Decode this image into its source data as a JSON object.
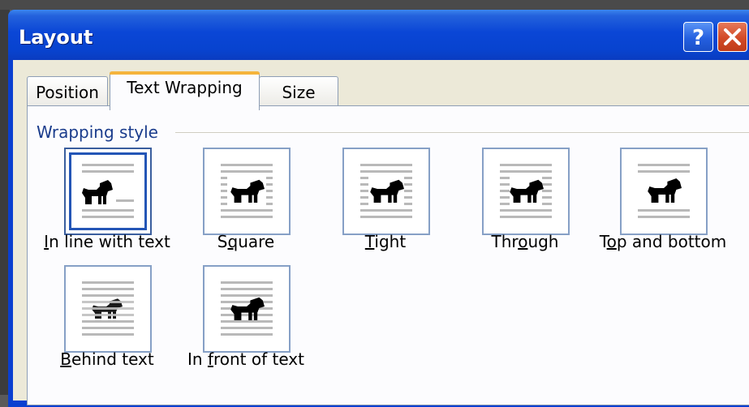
{
  "window": {
    "title": "Layout"
  },
  "title_buttons": {
    "help": "?",
    "close": "×"
  },
  "tabs": [
    {
      "id": "position",
      "label": "Position",
      "selected": false
    },
    {
      "id": "text-wrapping",
      "label": "Text Wrapping",
      "selected": true
    },
    {
      "id": "size",
      "label": "Size",
      "selected": false
    }
  ],
  "wrapping": {
    "group_label": "Wrapping style",
    "options": [
      {
        "id": "in-line",
        "pre": "",
        "key": "I",
        "post": "n line with text",
        "selected": true
      },
      {
        "id": "square",
        "pre": "S",
        "key": "q",
        "post": "uare",
        "selected": false
      },
      {
        "id": "tight",
        "pre": "",
        "key": "T",
        "post": "ight",
        "selected": false
      },
      {
        "id": "through",
        "pre": "Thr",
        "key": "o",
        "post": "ugh",
        "selected": false
      },
      {
        "id": "top-bottom",
        "pre": "T",
        "key": "o",
        "post": "p and bottom",
        "selected": false
      },
      {
        "id": "behind",
        "pre": "",
        "key": "B",
        "post": "ehind text",
        "selected": false
      },
      {
        "id": "in-front",
        "pre": "In ",
        "key": "f",
        "post": "ront of text",
        "selected": false
      }
    ]
  },
  "colors": {
    "titlebar": "#0a46d6",
    "accent_tab": "#f5b43c",
    "group_label": "#1a3c8c",
    "selection": "#2456b6"
  }
}
